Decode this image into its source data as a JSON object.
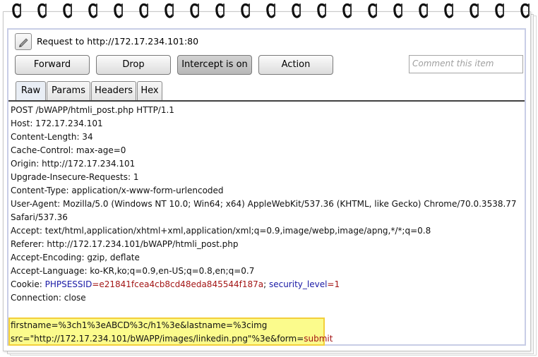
{
  "toolbar": {
    "request_label": "Request to http://172.17.234.101:80",
    "forward_label": "Forward",
    "drop_label": "Drop",
    "intercept_label": "Intercept is on",
    "action_label": "Action",
    "comment_placeholder": "Comment this item"
  },
  "tabs": [
    {
      "label": "Raw"
    },
    {
      "label": "Params"
    },
    {
      "label": "Headers"
    },
    {
      "label": "Hex"
    }
  ],
  "request": {
    "line1": "POST /bWAPP/htmli_post.php HTTP/1.1",
    "line2": "Host: 172.17.234.101",
    "line3": "Content-Length: 34",
    "line4": "Cache-Control: max-age=0",
    "line5": "Origin: http://172.17.234.101",
    "line6": "Upgrade-Insecure-Requests: 1",
    "line7": "Content-Type: application/x-www-form-urlencoded",
    "line8": "User-Agent: Mozilla/5.0 (Windows NT 10.0; Win64; x64) AppleWebKit/537.36 (KHTML, like Gecko) Chrome/70.0.3538.77",
    "line9": "Safari/537.36",
    "line10": "Accept: text/html,application/xhtml+xml,application/xml;q=0.9,image/webp,image/apng,*/*;q=0.8",
    "line11": "Referer: http://172.17.234.101/bWAPP/htmli_post.php",
    "line12": "Accept-Encoding: gzip, deflate",
    "line13": "Accept-Language: ko-KR,ko;q=0.9,en-US;q=0.8,en;q=0.7",
    "cookie": {
      "prefix": "Cookie: ",
      "key1": "PHPSESSID",
      "val1": "=e21841fcea4cb8cd48eda845544f187a",
      "sep": "; ",
      "key2": "security_level",
      "val2": "=1"
    },
    "line15": "Connection: close",
    "body1": "firstname=%3ch1%3eABCD%3c/h1%3e&lastname=%3cimg",
    "body2_a": "src=\"http://172.17.234.101/bWAPP/images/linkedin.png\"%3e&form=",
    "body2_b": "submit"
  },
  "colors": {
    "highlight": "#fbfb8c",
    "highlight_border": "#f3cf3a",
    "cookie_key": "#1a1aa6",
    "cookie_value": "#a31515",
    "panel_border": "#c8cde6"
  },
  "icons": [
    "spiral-ring-icon",
    "pencil-icon"
  ]
}
